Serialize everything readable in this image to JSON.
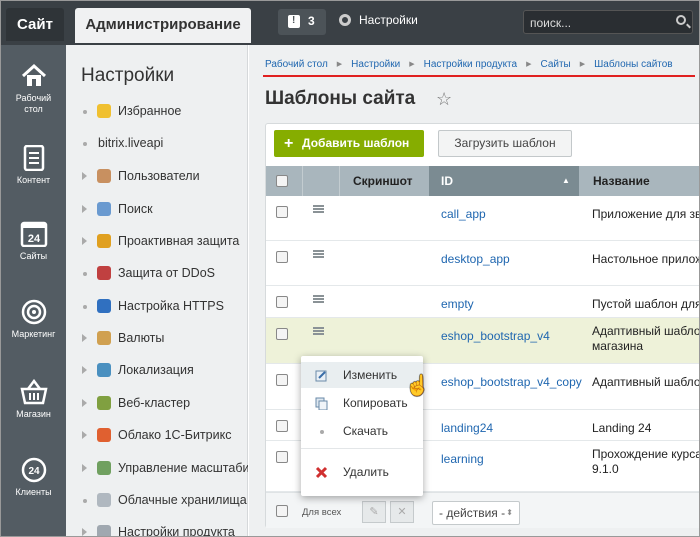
{
  "topbar": {
    "site_tab": "Сайт",
    "admin_tab": "Администрирование",
    "notif_count": "3",
    "settings": "Настройки",
    "search_placeholder": "поиск..."
  },
  "leftnav": [
    {
      "label": "Рабочий\nстол",
      "icon": "home-icon"
    },
    {
      "label": "Контент",
      "icon": "document-icon"
    },
    {
      "label": "Сайты",
      "icon": "calendar-24-icon"
    },
    {
      "label": "Маркетинг",
      "icon": "target-icon"
    },
    {
      "label": "Магазин",
      "icon": "basket-icon"
    },
    {
      "label": "Клиенты",
      "icon": "clients-24-icon"
    }
  ],
  "nav_calendar_num": "24",
  "sidebar": {
    "title": "Настройки",
    "items": [
      {
        "label": "Избранное",
        "icon": "star-icon",
        "color": "#f0c030",
        "kind": "dot"
      },
      {
        "label": "bitrix.liveapi",
        "icon": "",
        "color": "",
        "kind": "dot"
      },
      {
        "label": "Пользователи",
        "icon": "user-icon",
        "color": "#c89060",
        "kind": "arrow"
      },
      {
        "label": "Поиск",
        "icon": "search-icon",
        "color": "#6a9ad0",
        "kind": "arrow"
      },
      {
        "label": "Проактивная защита",
        "icon": "lock-icon",
        "color": "#e0a020",
        "kind": "arrow"
      },
      {
        "label": "Защита от DDoS",
        "icon": "shield-icon",
        "color": "#c04040",
        "kind": "dot"
      },
      {
        "label": "Настройка HTTPS",
        "icon": "https-lock-icon",
        "color": "#3070c0",
        "kind": "dot"
      },
      {
        "label": "Валюты",
        "icon": "currency-icon",
        "color": "#d0a050",
        "kind": "arrow"
      },
      {
        "label": "Локализация",
        "icon": "globe-icon",
        "color": "#4a90c0",
        "kind": "arrow"
      },
      {
        "label": "Веб-кластер",
        "icon": "cluster-icon",
        "color": "#80a040",
        "kind": "arrow"
      },
      {
        "label": "Облако 1С-Битрикс",
        "icon": "cloud-icon",
        "color": "#e06030",
        "kind": "arrow"
      },
      {
        "label": "Управление масштабир",
        "icon": "scale-icon",
        "color": "#70a060",
        "kind": "arrow"
      },
      {
        "label": "Облачные хранилища",
        "icon": "storage-icon",
        "color": "#b0b8c0",
        "kind": "dot"
      },
      {
        "label": "Настройки продукта",
        "icon": "product-settings-icon",
        "color": "#a0a8b0",
        "kind": "arrow"
      }
    ]
  },
  "breadcrumbs": [
    "Рабочий стол",
    "Настройки",
    "Настройки продукта",
    "Сайты",
    "Шаблоны сайтов"
  ],
  "page_title": "Шаблоны сайта",
  "toolbar": {
    "add": "Добавить шаблон",
    "load": "Загрузить шаблон"
  },
  "table": {
    "headers": {
      "screenshot": "Скриншот",
      "id": "ID",
      "name": "Название"
    },
    "rows": [
      {
        "id": "call_app",
        "name": "Приложение для зв"
      },
      {
        "id": "desktop_app",
        "name": "Настольное прилож"
      },
      {
        "id": "empty",
        "name": "Пустой шаблон для"
      },
      {
        "id": "eshop_bootstrap_v4",
        "name": "Адаптивный шабло",
        "name2": "магазина"
      },
      {
        "id": "eshop_bootstrap_v4_copy",
        "name": "Адаптивный шабло"
      },
      {
        "id": "landing24",
        "name": "Landing 24"
      },
      {
        "id": "learning",
        "name": "Прохождение курса",
        "name2": "9.1.0"
      }
    ]
  },
  "footer": {
    "for_all": "Для всех",
    "actions": "- действия -"
  },
  "context_menu": {
    "items": [
      "Изменить",
      "Копировать",
      "Скачать",
      "Удалить"
    ]
  },
  "colors": {
    "accent_red": "#e02020",
    "add_green": "#86ad00",
    "link": "#2067b0"
  }
}
